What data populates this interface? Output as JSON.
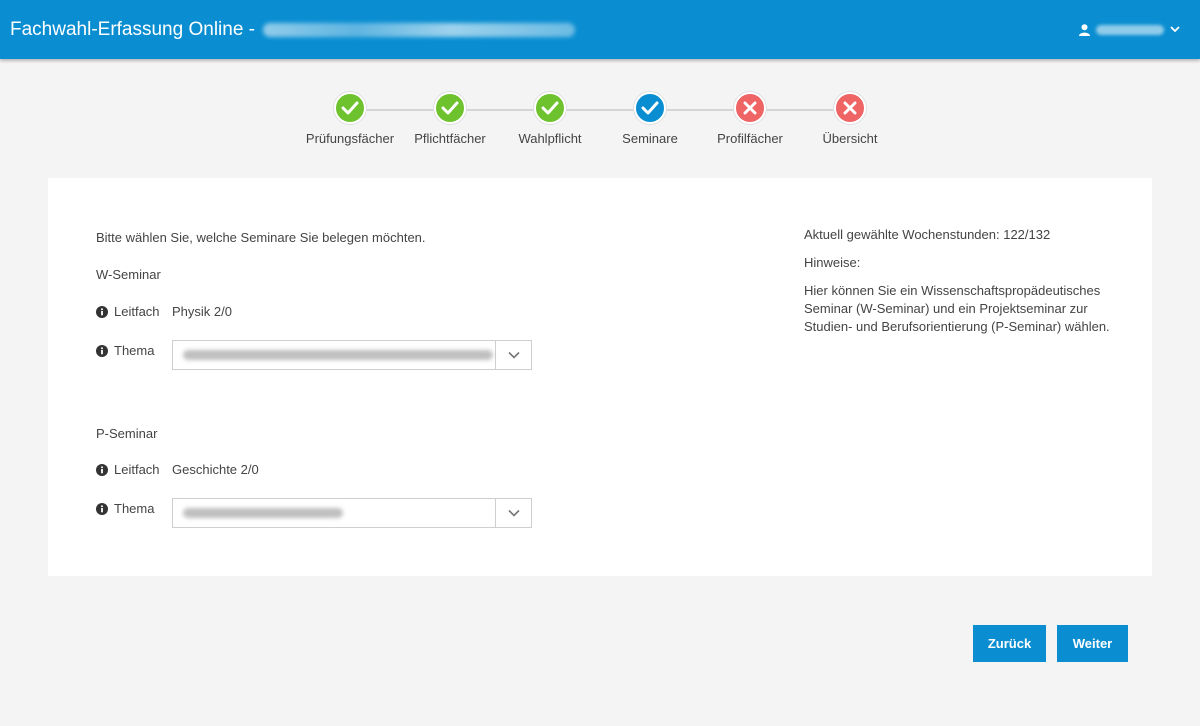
{
  "header": {
    "title": "Fachwahl-Erfassung Online -",
    "school_name_redacted": true,
    "user_name_redacted": true,
    "bg_color": "#0a8ed1"
  },
  "stepper": {
    "steps": [
      {
        "label": "Prüfungsfächer",
        "status": "done"
      },
      {
        "label": "Pflichtfächer",
        "status": "done"
      },
      {
        "label": "Wahlpflicht",
        "status": "done"
      },
      {
        "label": "Seminare",
        "status": "current"
      },
      {
        "label": "Profilfächer",
        "status": "error"
      },
      {
        "label": "Übersicht",
        "status": "error"
      }
    ],
    "colors": {
      "done": "#6dc22e",
      "current": "#0a8ed1",
      "error": "#ef6464"
    }
  },
  "form": {
    "intro": "Bitte wählen Sie, welche Seminare Sie belegen möchten.",
    "w_seminar": {
      "title": "W-Seminar",
      "leitfach_label": "Leitfach",
      "leitfach_value": "Physik 2/0",
      "thema_label": "Thema"
    },
    "p_seminar": {
      "title": "P-Seminar",
      "leitfach_label": "Leitfach",
      "leitfach_value": "Geschichte 2/0",
      "thema_label": "Thema"
    }
  },
  "sidebar": {
    "hours": "Aktuell gewählte Wochenstunden: 122/132",
    "hints_title": "Hinweise:",
    "hints_text": "Hier können Sie ein Wissenschaftspropädeutisches Seminar (W-Seminar) und ein Projektseminar zur Studien- und Berufsorientierung (P-Seminar) wählen."
  },
  "buttons": {
    "back": "Zurück",
    "next": "Weiter"
  }
}
